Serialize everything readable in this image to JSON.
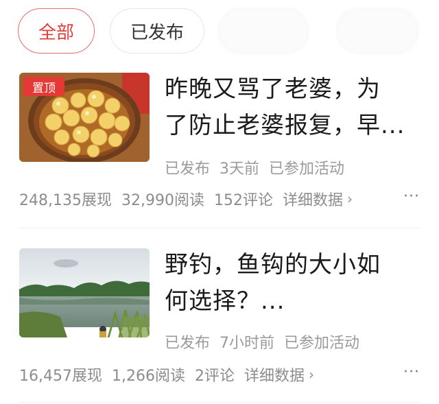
{
  "tabs": {
    "all": "全部",
    "published": "已发布"
  },
  "articles": [
    {
      "badge": "置顶",
      "title_line1": "昨晚又骂了老婆，为",
      "title_line2": "了防止老婆报复，早...",
      "status": "已发布",
      "time": "3天前",
      "activity": "已参加活动",
      "impressions": "248,135展现",
      "reads": "32,990阅读",
      "comments": "152评论",
      "details": "详细数据",
      "more": "···"
    },
    {
      "title_line1": "野钓，鱼钩的大小如",
      "title_line2": "何选择？...",
      "status": "已发布",
      "time": "7小时前",
      "activity": "已参加活动",
      "impressions": "16,457展现",
      "reads": "1,266阅读",
      "comments": "2评论",
      "details": "详细数据",
      "more": "···"
    }
  ],
  "colors": {
    "accent": "#e0403a",
    "badge": "#e53935"
  }
}
